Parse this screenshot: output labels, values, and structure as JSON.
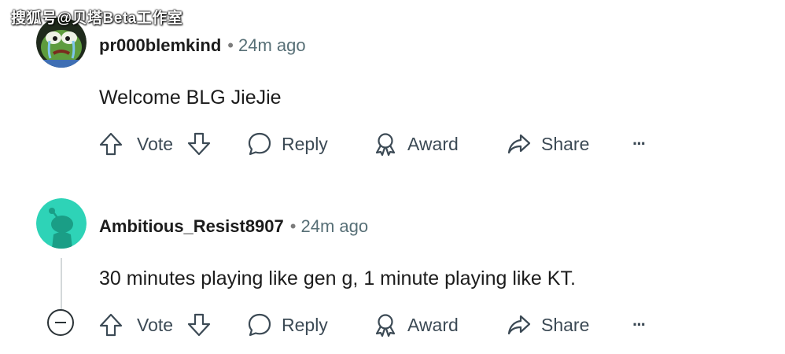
{
  "watermark": "搜狐号@贝塔Beta工作室",
  "comments": [
    {
      "username": "pr000blemkind",
      "separator": "•",
      "time": "24m ago",
      "text": "Welcome BLG JieJie",
      "actions": {
        "vote": "Vote",
        "reply": "Reply",
        "award": "Award",
        "share": "Share",
        "more": "···"
      },
      "avatar_icon": "pepe-crying-avatar"
    },
    {
      "username": "Ambitious_Resist8907",
      "separator": "•",
      "time": "24m ago",
      "text": "30 minutes playing like gen g, 1 minute playing like KT.",
      "actions": {
        "vote": "Vote",
        "reply": "Reply",
        "award": "Award",
        "share": "Share",
        "more": "···"
      },
      "avatar_icon": "reddit-snoo-avatar"
    }
  ],
  "colors": {
    "text": "#1c1c1c",
    "meta": "#576f76",
    "action": "#3c4a55",
    "avatar2_bg": "#2ed3b7",
    "avatar2_fg": "#1a9e86"
  }
}
